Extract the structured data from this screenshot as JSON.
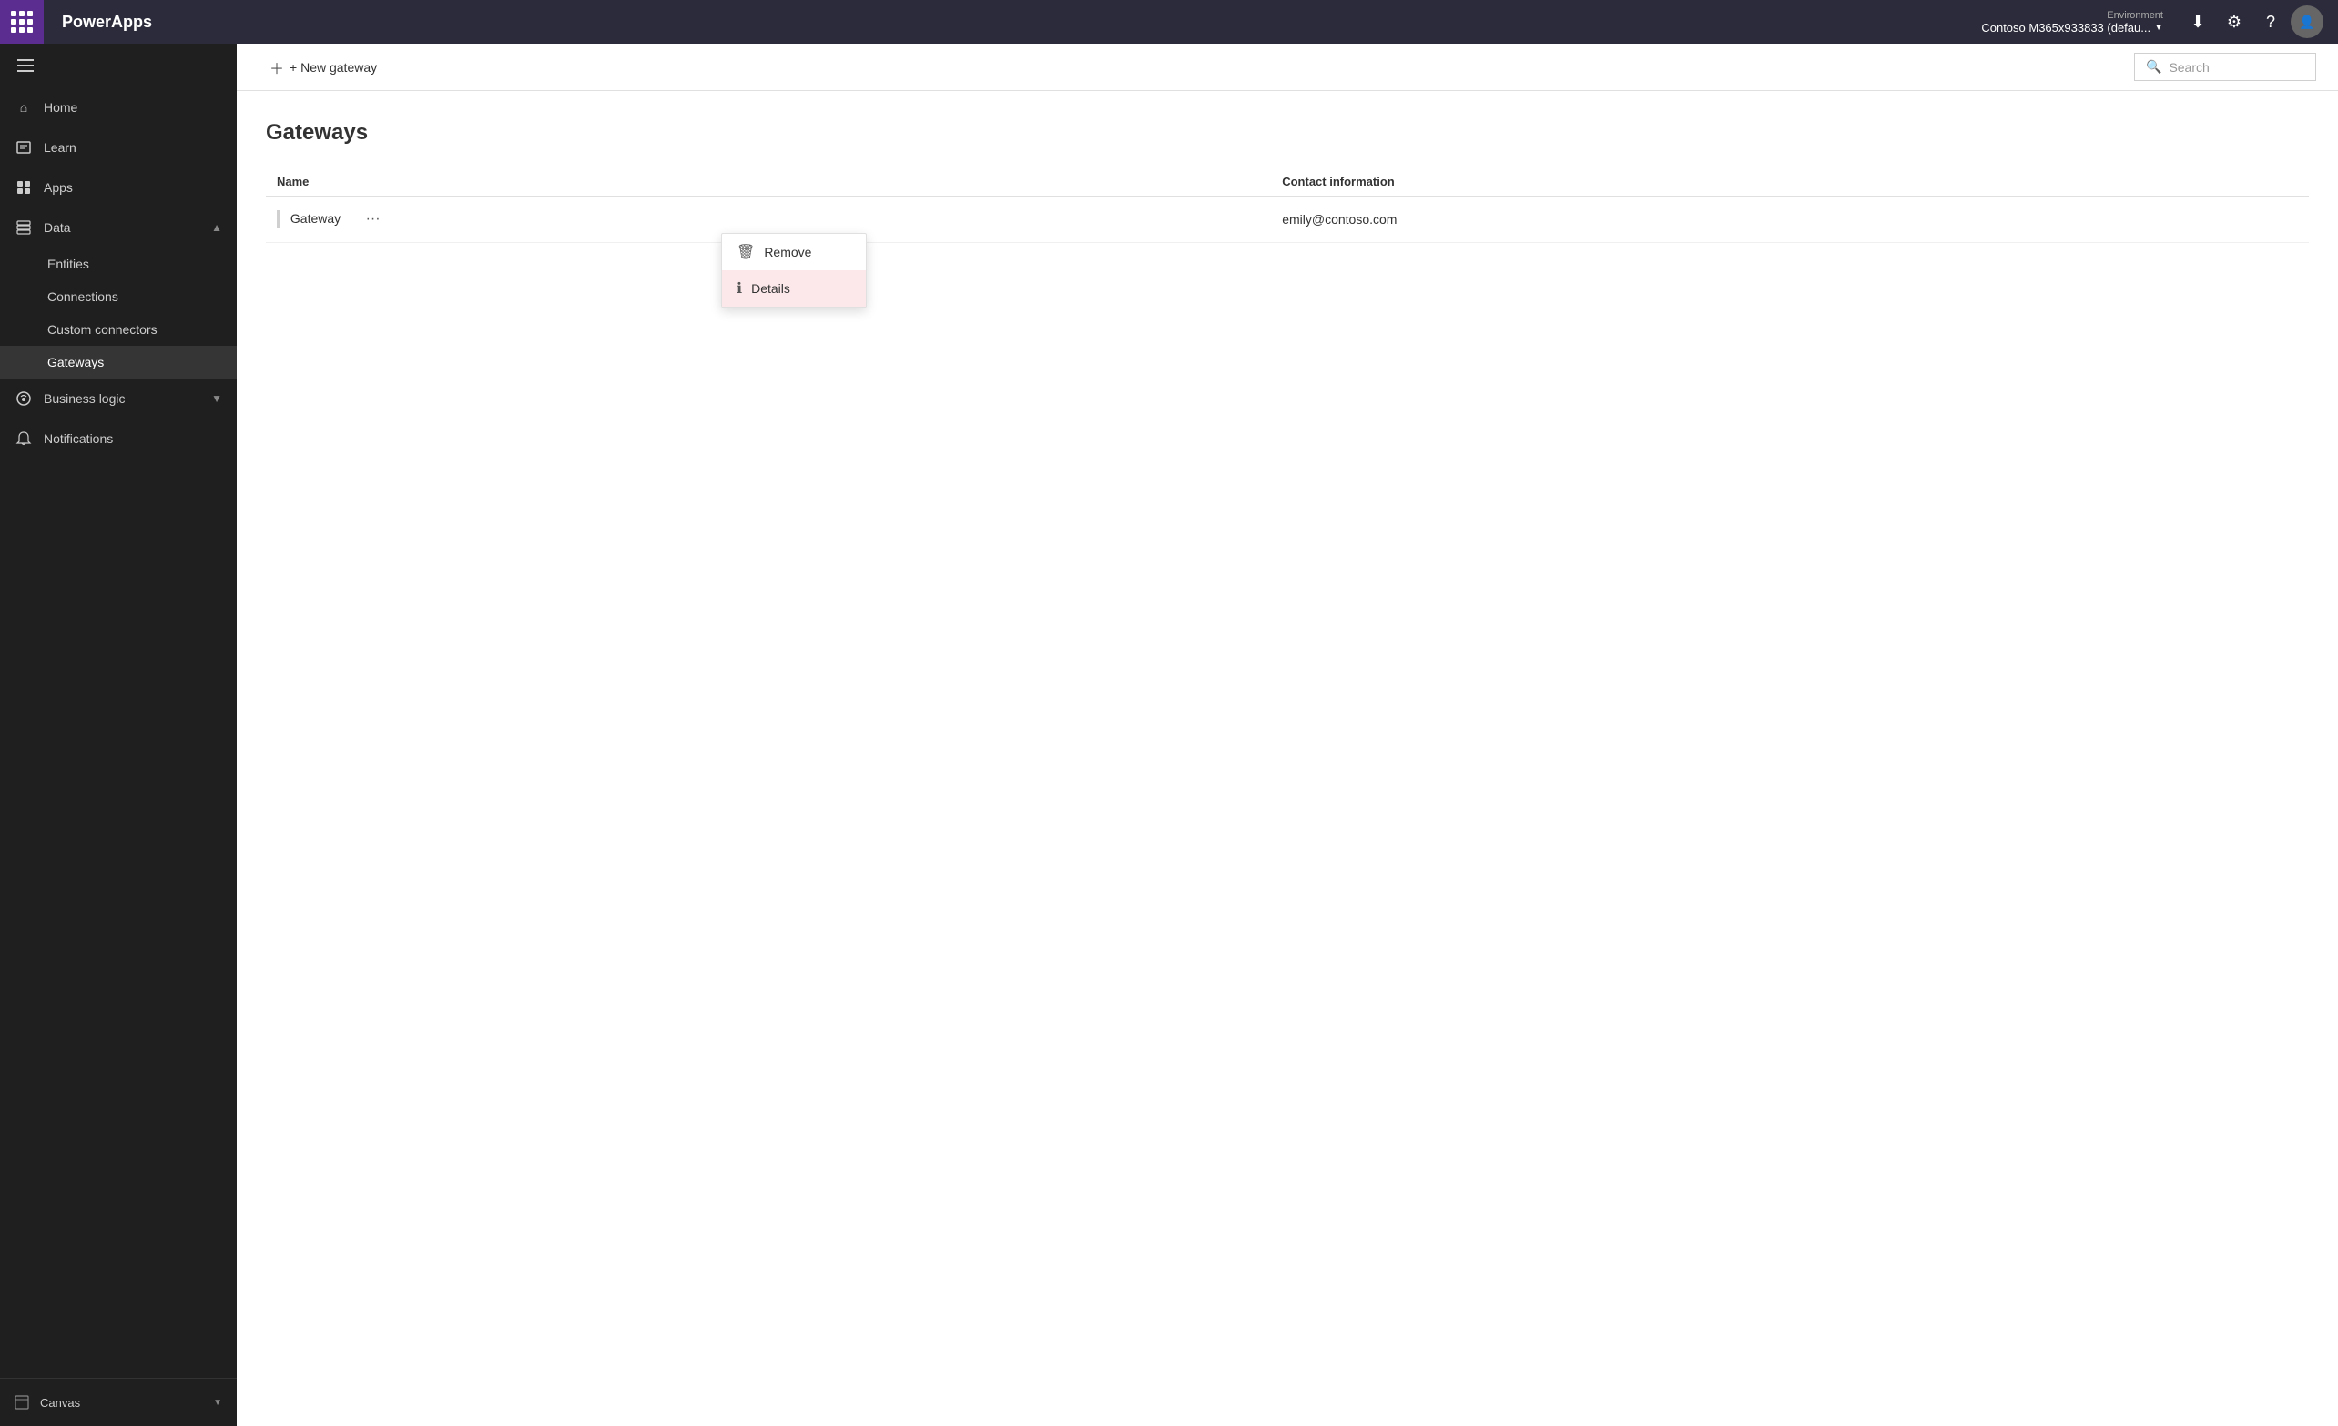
{
  "topbar": {
    "brand": "PowerApps",
    "env_label": "Environment",
    "env_name": "Contoso M365x933833 (defau...",
    "search_placeholder": "Search"
  },
  "sidebar": {
    "toggle_label": "Toggle navigation",
    "items": [
      {
        "id": "home",
        "label": "Home",
        "icon": "home"
      },
      {
        "id": "learn",
        "label": "Learn",
        "icon": "learn"
      },
      {
        "id": "apps",
        "label": "Apps",
        "icon": "apps"
      },
      {
        "id": "data",
        "label": "Data",
        "icon": "data",
        "expanded": true,
        "chevron": "▲"
      },
      {
        "id": "entities",
        "label": "Entities",
        "sub": true
      },
      {
        "id": "connections",
        "label": "Connections",
        "sub": true
      },
      {
        "id": "custom-connectors",
        "label": "Custom connectors",
        "sub": true
      },
      {
        "id": "gateways",
        "label": "Gateways",
        "sub": true,
        "active": true
      },
      {
        "id": "business-logic",
        "label": "Business logic",
        "icon": "biz",
        "chevron": "▼"
      },
      {
        "id": "notifications",
        "label": "Notifications",
        "icon": "notif"
      }
    ],
    "bottom": {
      "label": "Canvas",
      "chevron": "▼"
    }
  },
  "toolbar": {
    "new_gateway_label": "+ New gateway"
  },
  "page": {
    "title": "Gateways",
    "columns": [
      "Name",
      "Contact information"
    ],
    "rows": [
      {
        "name": "Gateway",
        "contact": "emily@contoso.com"
      }
    ]
  },
  "dropdown": {
    "items": [
      {
        "id": "remove",
        "label": "Remove",
        "icon": "🗑"
      },
      {
        "id": "details",
        "label": "Details",
        "icon": "ℹ"
      }
    ]
  }
}
